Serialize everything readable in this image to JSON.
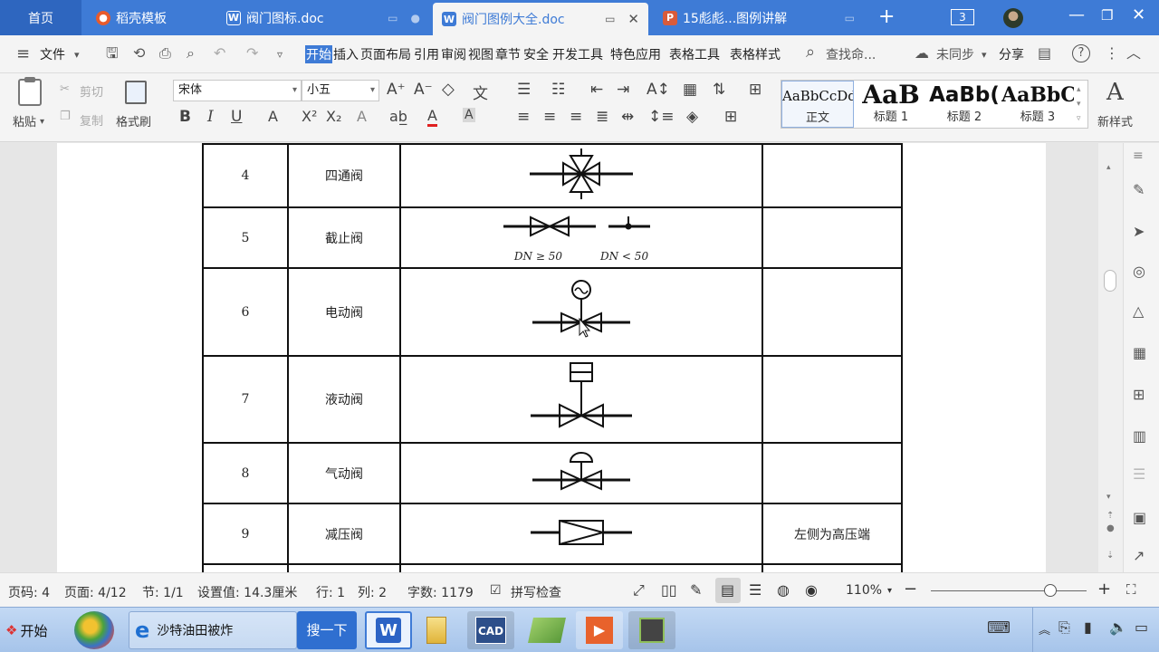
{
  "tabs": {
    "home": "首页",
    "template": "稻壳模板",
    "doc1": "阀门图标.doc",
    "doc2": "阀门图例大全.doc",
    "doc3": "15彪彪...图例讲解",
    "count": "3",
    "wps_icon": "W",
    "ppt_icon": "P"
  },
  "menubar": {
    "file": "文件",
    "items": [
      "开始",
      "插入",
      "页面布局",
      "引用",
      "审阅",
      "视图",
      "章节",
      "安全",
      "开发工具",
      "特色应用",
      "表格工具",
      "表格样式"
    ],
    "search": "查找命...",
    "sync": "未同步",
    "share": "分享"
  },
  "ribbon": {
    "paste": "粘贴",
    "cut": "剪切",
    "copy": "复制",
    "format_painter": "格式刷",
    "font_name": "宋体",
    "font_size": "小五",
    "styles": [
      {
        "preview": "AaBbCcDd",
        "label": "正文"
      },
      {
        "preview": "AaB",
        "label": "标题 1"
      },
      {
        "preview": "AaBb(",
        "label": "标题 2"
      },
      {
        "preview": "AaBbC",
        "label": "标题 3"
      }
    ],
    "new_style": "新样式",
    "bold": "B",
    "italic": "I",
    "underline": "U"
  },
  "table": {
    "rows": [
      {
        "index": "4",
        "name": "四通阀",
        "note": ""
      },
      {
        "index": "5",
        "name": "截止阀",
        "note": "",
        "label_left": "DN ≥ 50",
        "label_right": "DN < 50"
      },
      {
        "index": "6",
        "name": "电动阀",
        "note": ""
      },
      {
        "index": "7",
        "name": "液动阀",
        "note": ""
      },
      {
        "index": "8",
        "name": "气动阀",
        "note": ""
      },
      {
        "index": "9",
        "name": "减压阀",
        "note": "左侧为高压端"
      }
    ]
  },
  "status": {
    "page_code": "页码: 4",
    "page": "页面: 4/12",
    "section": "节: 1/1",
    "position": "设置值: 14.3厘米",
    "line": "行: 1",
    "column": "列: 2",
    "words": "字数: 1179",
    "spell": "拼写检查",
    "zoom": "110%",
    "zoom_level": 0.77
  },
  "taskbar": {
    "start": "开始",
    "ie_title": "沙特油田被炸",
    "search_btn": "搜一下"
  },
  "colors": {
    "tabbar": "#3e7bd6",
    "accent": "#3e7bd6"
  }
}
